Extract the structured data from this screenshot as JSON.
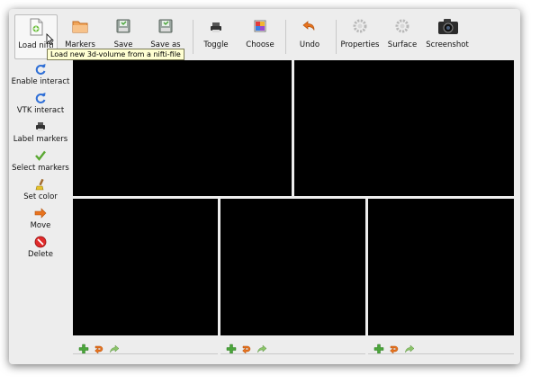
{
  "toolbar": {
    "items": [
      {
        "label": "Load nifti",
        "icon": "load-file-icon"
      },
      {
        "label": "Markers",
        "icon": "markers-icon"
      },
      {
        "label": "Save",
        "icon": "save-icon"
      },
      {
        "label": "Save as",
        "icon": "save-as-icon"
      },
      {
        "label": "Toggle",
        "icon": "toggle-icon"
      },
      {
        "label": "Choose",
        "icon": "choose-icon"
      },
      {
        "label": "Undo",
        "icon": "undo-icon"
      },
      {
        "label": "Properties",
        "icon": "properties-icon"
      },
      {
        "label": "Surface",
        "icon": "surface-icon"
      },
      {
        "label": "Screenshot",
        "icon": "camera-icon"
      }
    ]
  },
  "tooltip": "Load new 3d-volume from a nifti-file",
  "sidebar": {
    "items": [
      {
        "label": "Enable interact",
        "icon": "refresh-icon"
      },
      {
        "label": "VTK interact",
        "icon": "refresh-icon"
      },
      {
        "label": "Label markers",
        "icon": "printer-icon"
      },
      {
        "label": "Select markers",
        "icon": "checkmark-icon"
      },
      {
        "label": "Set color",
        "icon": "brush-icon"
      },
      {
        "label": "Move",
        "icon": "arrow-right-icon"
      },
      {
        "label": "Delete",
        "icon": "delete-icon"
      }
    ]
  },
  "view_toolbar_icons": [
    "add-icon",
    "turn-icon",
    "redo-icon"
  ],
  "colors": {
    "window_bg": "#ededed",
    "view_bg": "#000000",
    "tooltip_bg": "#ffffd2",
    "add_green": "#4aa53a",
    "turn_orange": "#e8731e"
  }
}
